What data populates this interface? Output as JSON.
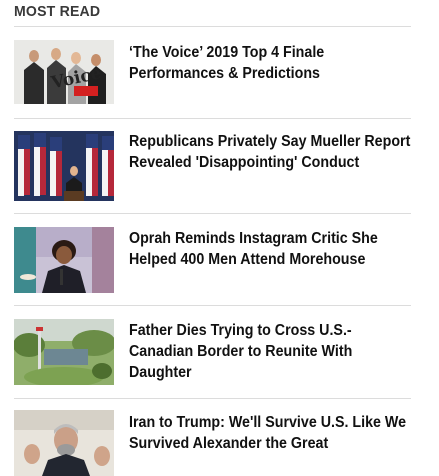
{
  "widget": {
    "heading": "MOST READ",
    "items": [
      {
        "title": "‘The Voice’ 2019 Top 4 Finale Performances & Predictions",
        "thumb": "the-voice-coaches-photo"
      },
      {
        "title": "Republicans Privately Say Mueller Report Revealed 'Disappointing' Conduct",
        "thumb": "flags-podium-photo"
      },
      {
        "title": "Oprah Reminds Instagram Critic She Helped 400 Men Attend Morehouse",
        "thumb": "oprah-speaking-photo"
      },
      {
        "title": "Father Dies Trying to Cross U.S.-Canadian Border to Reunite With Daughter",
        "thumb": "border-river-photo"
      },
      {
        "title": "Iran to Trump: We'll Survive U.S. Like We Survived Alexander the Great",
        "thumb": "iran-minister-photo"
      }
    ]
  },
  "thumb_logo_text": "Voice"
}
